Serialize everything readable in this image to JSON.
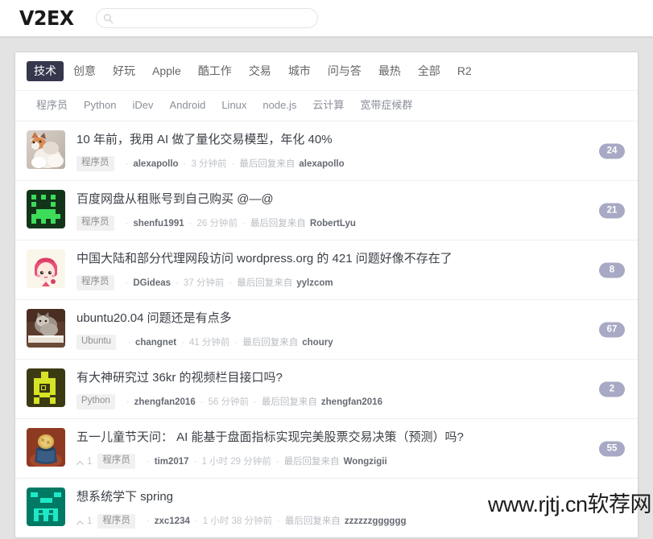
{
  "header": {
    "brand": "V2EX",
    "search": {
      "placeholder": "",
      "value": "",
      "icon": "search-icon"
    }
  },
  "tabs": [
    {
      "label": "技术",
      "active": true
    },
    {
      "label": "创意",
      "active": false
    },
    {
      "label": "好玩",
      "active": false
    },
    {
      "label": "Apple",
      "active": false
    },
    {
      "label": "酷工作",
      "active": false
    },
    {
      "label": "交易",
      "active": false
    },
    {
      "label": "城市",
      "active": false
    },
    {
      "label": "问与答",
      "active": false
    },
    {
      "label": "最热",
      "active": false
    },
    {
      "label": "全部",
      "active": false
    },
    {
      "label": "R2",
      "active": false
    }
  ],
  "subnav": [
    {
      "label": "程序员"
    },
    {
      "label": "Python"
    },
    {
      "label": "iDev"
    },
    {
      "label": "Android"
    },
    {
      "label": "Linux"
    },
    {
      "label": "node.js"
    },
    {
      "label": "云计算"
    },
    {
      "label": "宽带症候群"
    }
  ],
  "topics": [
    {
      "title": "10 年前，我用 AI 做了量化交易模型，年化 40%",
      "node": "程序员",
      "author": "alexapollo",
      "time": "3 分钟前",
      "last_reply_label": "最后回复来自",
      "last_reply_user": "alexapollo",
      "replies": "24",
      "votes": "",
      "avatar": "cat-photo-avatar"
    },
    {
      "title": "百度网盘从租账号到自己购买 @—@",
      "node": "程序员",
      "author": "shenfu1991",
      "time": "26 分钟前",
      "last_reply_label": "最后回复来自",
      "last_reply_user": "RobertLyu",
      "replies": "21",
      "votes": "",
      "avatar": "green-pixel-avatar"
    },
    {
      "title": "中国大陆和部分代理网段访问 wordpress.org 的 421 问题好像不存在了",
      "node": "程序员",
      "author": "DGideas",
      "time": "37 分钟前",
      "last_reply_label": "最后回复来自",
      "last_reply_user": "yylzcom",
      "replies": "8",
      "votes": "",
      "avatar": "pink-anime-avatar"
    },
    {
      "title": "ubuntu20.04 问题还是有点多",
      "node": "Ubuntu",
      "author": "changnet",
      "time": "41 分钟前",
      "last_reply_label": "最后回复来自",
      "last_reply_user": "choury",
      "replies": "67",
      "votes": "",
      "avatar": "cat-book-photo-avatar"
    },
    {
      "title": "有大神研究过 36kr 的视频栏目接口吗?",
      "node": "Python",
      "author": "zhengfan2016",
      "time": "56 分钟前",
      "last_reply_label": "最后回复来自",
      "last_reply_user": "zhengfan2016",
      "replies": "2",
      "votes": "",
      "avatar": "olive-pixel-avatar"
    },
    {
      "title": "五一儿童节天问： AI 能基于盘面指标实现完美股票交易决策（预测）吗?",
      "node": "程序员",
      "author": "tim2017",
      "time": "1 小时 29 分钟前",
      "last_reply_label": "最后回复来自",
      "last_reply_user": "Wongzigii",
      "replies": "55",
      "votes": "1",
      "avatar": "jar-photo-avatar"
    },
    {
      "title": "想系统学下 spring",
      "node": "程序员",
      "author": "zxc1234",
      "time": "1 小时 38 分钟前",
      "last_reply_label": "最后回复来自",
      "last_reply_user": "zzzzzzgggggg",
      "replies": "",
      "votes": "1",
      "avatar": "teal-pixel-avatar"
    }
  ],
  "watermark": {
    "text": "www.rjtj.cn软荐网"
  },
  "colors": {
    "page_bg": "#e3e3e3",
    "active_tab_bg": "#36374d",
    "reply_badge_bg": "#a8a9c4",
    "node_tag_bg": "#f1f1f1"
  }
}
